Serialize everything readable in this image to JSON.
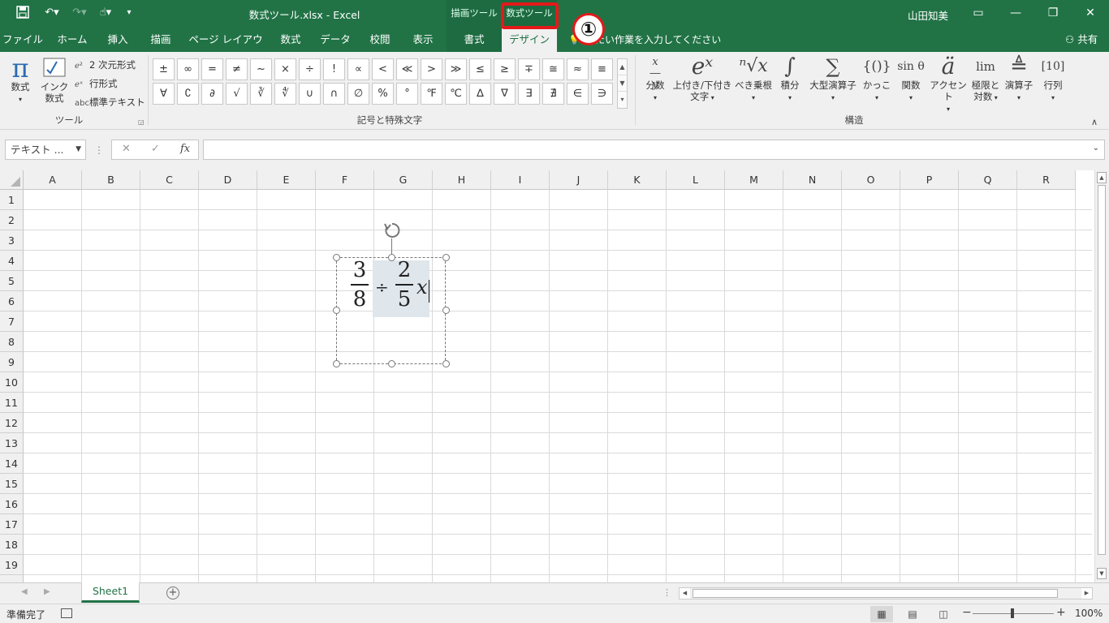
{
  "title_bar": {
    "document_title": "数式ツール.xlsx - Excel",
    "context_tab_drawing": "描画ツール",
    "context_tab_equation": "数式ツール",
    "callout_number": "①",
    "user_name": "山田知美"
  },
  "ribbon_tabs": [
    {
      "label": "ファイル"
    },
    {
      "label": "ホーム"
    },
    {
      "label": "挿入"
    },
    {
      "label": "描画"
    },
    {
      "label": "ページ レイアウト"
    },
    {
      "label": "数式"
    },
    {
      "label": "データ"
    },
    {
      "label": "校閲"
    },
    {
      "label": "表示"
    },
    {
      "label": "書式"
    },
    {
      "label": "デザイン"
    }
  ],
  "tell_me": "したい作業を入力してください",
  "share_label": "共有",
  "tools_group": {
    "label": "ツール",
    "equation_button": "数式",
    "ink_button_line1": "インク",
    "ink_button_line2": "数式",
    "professional": "2 次元形式",
    "linear": "行形式",
    "normal_text": "標準テキスト",
    "normal_text_icon": "abc"
  },
  "symbols_group": {
    "label": "記号と特殊文字",
    "row1": [
      "±",
      "∞",
      "=",
      "≠",
      "~",
      "×",
      "÷",
      "!",
      "∝",
      "<",
      "≪",
      ">",
      "≫",
      "≤",
      "≥",
      "∓",
      "≅",
      "≈",
      "≡"
    ],
    "row2": [
      "∀",
      "∁",
      "∂",
      "√",
      "∛",
      "∜",
      "∪",
      "∩",
      "∅",
      "%",
      "°",
      "℉",
      "℃",
      "∆",
      "∇",
      "∃",
      "∄",
      "∈",
      "∋"
    ]
  },
  "structures_group": {
    "label": "構造",
    "buttons": [
      {
        "label": "分数",
        "glyph": "x/y"
      },
      {
        "label": "上付き/下付き",
        "label2": "文字",
        "glyph": "eˣ"
      },
      {
        "label": "べき乗根",
        "glyph": "ⁿ√x"
      },
      {
        "label": "積分",
        "glyph": "∫"
      },
      {
        "label": "大型演算子",
        "glyph": "∑"
      },
      {
        "label": "かっこ",
        "glyph": "{()}"
      },
      {
        "label": "関数",
        "glyph": "sin θ"
      },
      {
        "label": "アクセント",
        "glyph": "ä"
      },
      {
        "label": "極限と",
        "label2": "対数",
        "glyph": "lim"
      },
      {
        "label": "演算子",
        "glyph": "≜"
      },
      {
        "label": "行列",
        "glyph": "[10]"
      }
    ]
  },
  "formula_bar": {
    "name_box": "テキスト ...",
    "cancel": "✕",
    "enter": "✓",
    "fx": "fx",
    "value": ""
  },
  "columns": [
    "A",
    "B",
    "C",
    "D",
    "E",
    "F",
    "G",
    "H",
    "I",
    "J",
    "K",
    "L",
    "M",
    "N",
    "O",
    "P",
    "Q",
    "R"
  ],
  "rows": [
    "1",
    "2",
    "3",
    "4",
    "5",
    "6",
    "7",
    "8",
    "9",
    "10",
    "11",
    "12",
    "13",
    "14",
    "15",
    "16",
    "17",
    "18",
    "19"
  ],
  "equation": {
    "frac1_num": "3",
    "frac1_den": "8",
    "operator": "÷",
    "frac2_num": "2",
    "frac2_den": "5",
    "variable": "x"
  },
  "sheet_tabs": {
    "active": "Sheet1"
  },
  "status_bar": {
    "status": "準備完了",
    "zoom": "100%"
  },
  "colors": {
    "excel_green": "#217346",
    "highlight_red": "#e51919"
  }
}
